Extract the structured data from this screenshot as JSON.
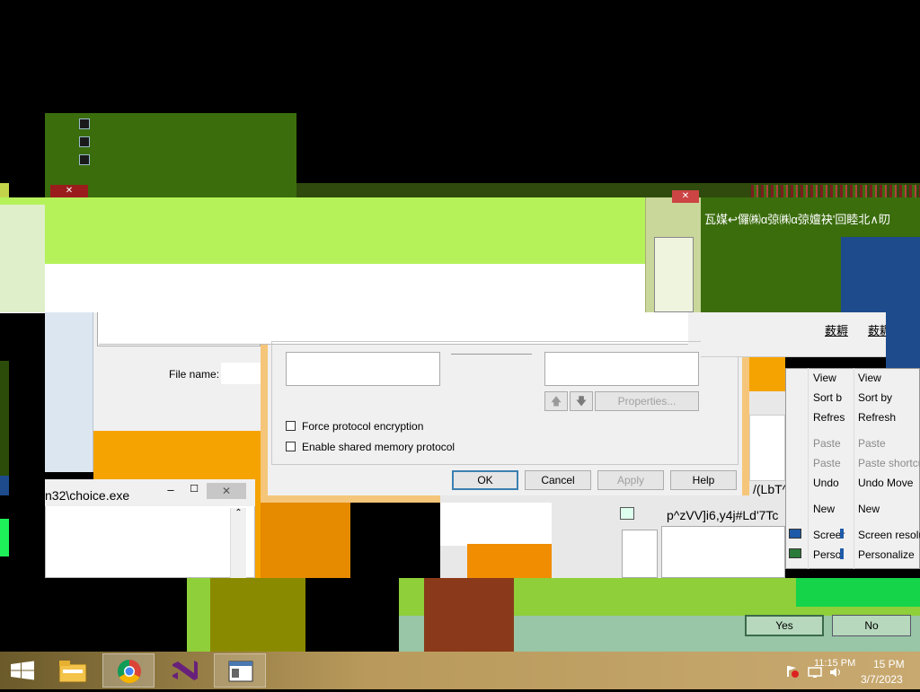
{
  "props_dialog": {
    "force_encryption_label": "Force protocol encryption",
    "shared_memory_label": "Enable shared memory protocol",
    "properties_label": "Properties...",
    "ok_label": "OK",
    "cancel_label": "Cancel",
    "apply_label": "Apply",
    "help_label": "Help"
  },
  "file_dialog": {
    "file_name_label": "File name:"
  },
  "cmd_window": {
    "title": "n32\\choice.exe"
  },
  "context_menu_left": {
    "items": [
      "View",
      "Sort b",
      "Refres",
      "Paste",
      "Paste",
      "Undo",
      "New",
      "Screer",
      "Perso"
    ]
  },
  "context_menu_right": {
    "items": [
      "View",
      "Sort by",
      "Refresh",
      "Paste",
      "Paste shortcu",
      "Undo Move",
      "New",
      "Screen resolu",
      "Personalize"
    ]
  },
  "garbled": {
    "cjk_text": "瓦媒↩儸㈱α弶㈱α弶嬗袂'回睦北∧旫",
    "line1": "/(LbT^",
    "line2": "p^zVV]i6,y4j#Ld'7Tc",
    "chars1": "薮耨",
    "chars2": "薮耨"
  },
  "msgbox": {
    "yes_label": "Yes",
    "no_label": "No"
  },
  "taskbar": {
    "time_a": "11:15 PM",
    "time_b": "15 PM",
    "date": "3/7/2023"
  }
}
